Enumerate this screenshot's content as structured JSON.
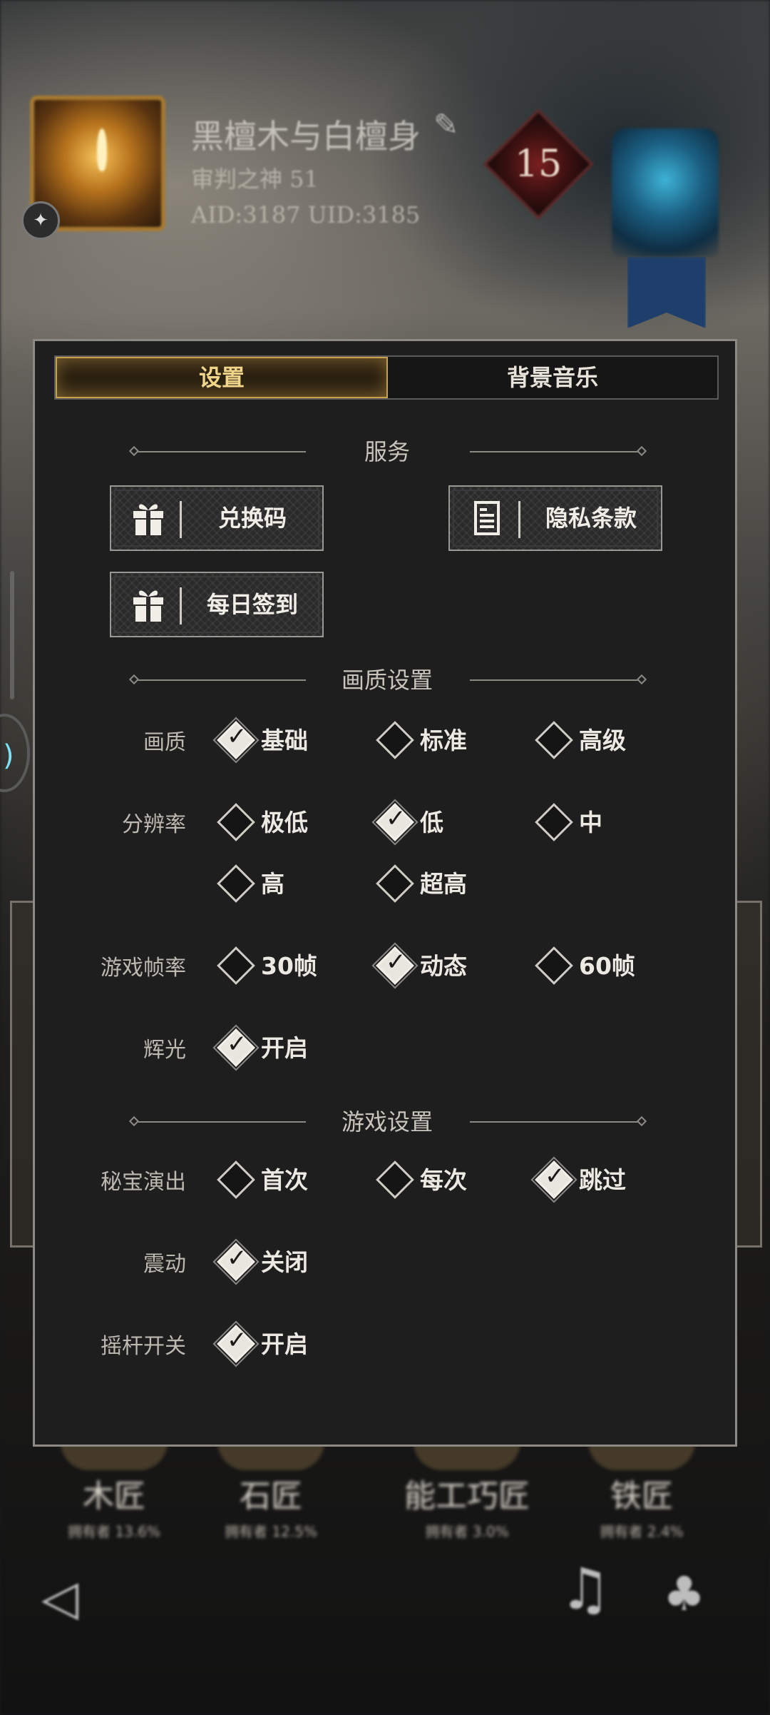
{
  "background": {
    "player": {
      "name": "黑檀木与白檀身",
      "title": "审判之神 51",
      "ids": "AID:3187 UID:3185"
    },
    "rank_number": "15",
    "footer": [
      {
        "name": "木匠",
        "sub": "拥有者 13.6%"
      },
      {
        "name": "石匠",
        "sub": "拥有者 12.5%"
      },
      {
        "name": "能工巧匠",
        "sub": "拥有者 3.0%"
      },
      {
        "name": "铁匠",
        "sub": "拥有者 2.4%"
      }
    ]
  },
  "tabs": [
    {
      "label": "设置",
      "active": true
    },
    {
      "label": "背景音乐",
      "active": false
    }
  ],
  "sections": {
    "service": "服务",
    "graphics": "画质设置",
    "game": "游戏设置"
  },
  "service_buttons": {
    "redeem": "兑换码",
    "privacy": "隐私条款",
    "checkin": "每日签到"
  },
  "graphics": {
    "quality": {
      "label": "画质",
      "options": [
        "基础",
        "标准",
        "高级"
      ],
      "selected": "基础"
    },
    "resolution": {
      "label": "分辨率",
      "options": [
        "极低",
        "低",
        "中",
        "高",
        "超高"
      ],
      "selected": "低"
    },
    "fps": {
      "label": "游戏帧率",
      "options": [
        "30帧",
        "动态",
        "60帧"
      ],
      "selected": "动态"
    },
    "glow": {
      "label": "辉光",
      "options": [
        "开启"
      ],
      "selected": "开启"
    }
  },
  "game": {
    "treasure": {
      "label": "秘宝演出",
      "options": [
        "首次",
        "每次",
        "跳过"
      ],
      "selected": "跳过"
    },
    "vibration": {
      "label": "震动",
      "options": [
        "关闭"
      ],
      "selected": "关闭"
    },
    "joystick": {
      "label": "摇杆开关",
      "options": [
        "开启"
      ],
      "selected": "开启"
    }
  },
  "colors": {
    "accent_gold": "#c9a04a",
    "panel_bg": "#1e1e1f",
    "panel_border": "#8d8a86"
  }
}
